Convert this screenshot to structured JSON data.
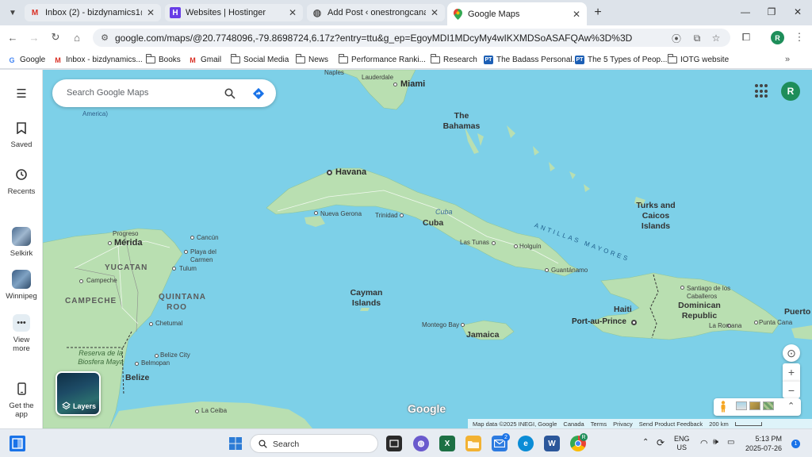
{
  "browser": {
    "tabs": [
      {
        "title": "Inbox (2) - bizdynamics1@gma",
        "favicon": "gmail-icon",
        "active": false
      },
      {
        "title": "Websites | Hostinger",
        "favicon": "hostinger-icon",
        "active": false
      },
      {
        "title": "Add Post ‹ onestrongcanadian.c",
        "favicon": "globe-icon",
        "active": false
      },
      {
        "title": "Google Maps",
        "favicon": "google-maps-icon",
        "active": true
      }
    ],
    "url": "google.com/maps/@20.7748096,-79.8698724,6.17z?entry=ttu&g_ep=EgoyMDI1MDcyMy4wIKXMDSoASAFQAw%3D%3D",
    "profile_initial": "R",
    "bookmarks": [
      {
        "label": "Google",
        "icon": "google-icon"
      },
      {
        "label": "Inbox - bizdynamics...",
        "icon": "gmail-icon"
      },
      {
        "label": "Books",
        "icon": "folder-icon"
      },
      {
        "label": "Gmail",
        "icon": "gmail-icon"
      },
      {
        "label": "Social Media",
        "icon": "folder-icon"
      },
      {
        "label": "News",
        "icon": "folder-icon"
      },
      {
        "label": "Performance Ranki...",
        "icon": "folder-icon"
      },
      {
        "label": "Research",
        "icon": "folder-icon"
      },
      {
        "label": "The Badass Personal...",
        "icon": "pt-icon"
      },
      {
        "label": "The 5 Types of Peop...",
        "icon": "pt-icon"
      },
      {
        "label": "IOTG website",
        "icon": "folder-icon"
      }
    ]
  },
  "maps": {
    "search_placeholder": "Search Google Maps",
    "profile_initial": "R",
    "rail": {
      "saved": "Saved",
      "recents": "Recents",
      "places": [
        "Selkirk",
        "Winnipeg"
      ],
      "view_more": "View more",
      "get_app": "Get the app"
    },
    "layers_label": "Layers",
    "google_logo": "Google",
    "attribution": {
      "map_data": "Map data ©2025 INEGI, Google",
      "canada": "Canada",
      "terms": "Terms",
      "privacy": "Privacy",
      "feedback": "Send Product Feedback",
      "scale": "200 km"
    },
    "labels": {
      "napres": "Naples",
      "lauderdale": "Lauderdale",
      "miami": "Miami",
      "america": "America)",
      "bahamas": "The Bahamas",
      "havana": "Havana",
      "turks": "Turks and Caicos Islands",
      "antillas": "ANTILLAS MAYORES",
      "nueva_gerona": "Nueva Gerona",
      "trinidad": "Trinidad",
      "cuba_water": "Cuba",
      "cuba": "Cuba",
      "las_tunas": "Las Tunas",
      "holguin": "Holguín",
      "guantanamo": "Guantánamo",
      "progreso": "Progreso",
      "merida": "Mérida",
      "cancun": "Cancún",
      "playa_del_carmen": "Playa del Carmen",
      "tulum": "Tulum",
      "yucatan": "YUCATAN",
      "campeche_city": "Campeche",
      "campeche_region": "CAMPECHE",
      "quintana_roo": "QUINTANA ROO",
      "chetumal": "Chetumal",
      "cayman": "Cayman Islands",
      "santiago": "Santiago de los Caballeros",
      "haiti": "Haiti",
      "dominican": "Dominican Republic",
      "port_au_prince": "Port-au-Prince",
      "la_romana": "La Romana",
      "punta_cana": "Punta Cana",
      "puerto": "Puerto",
      "montego_bay": "Montego Bay",
      "jamaica": "Jamaica",
      "reserva": "Reserva de la Biosfera Maya",
      "belize_city": "Belize City",
      "belmopan": "Belmopan",
      "belize": "Belize",
      "la_ceiba": "La Ceiba"
    }
  },
  "taskbar": {
    "search_label": "Search",
    "lang_top": "ENG",
    "lang_bottom": "US",
    "time": "5:13 PM",
    "date": "2025-07-26",
    "mail_badge": "2",
    "notification_badge": "1",
    "chrome_badge": "R"
  },
  "colors": {
    "water": "#7dd0e8",
    "land": "#b9dfb1",
    "accent": "#1a73e8",
    "profile": "#1e8e5a"
  }
}
